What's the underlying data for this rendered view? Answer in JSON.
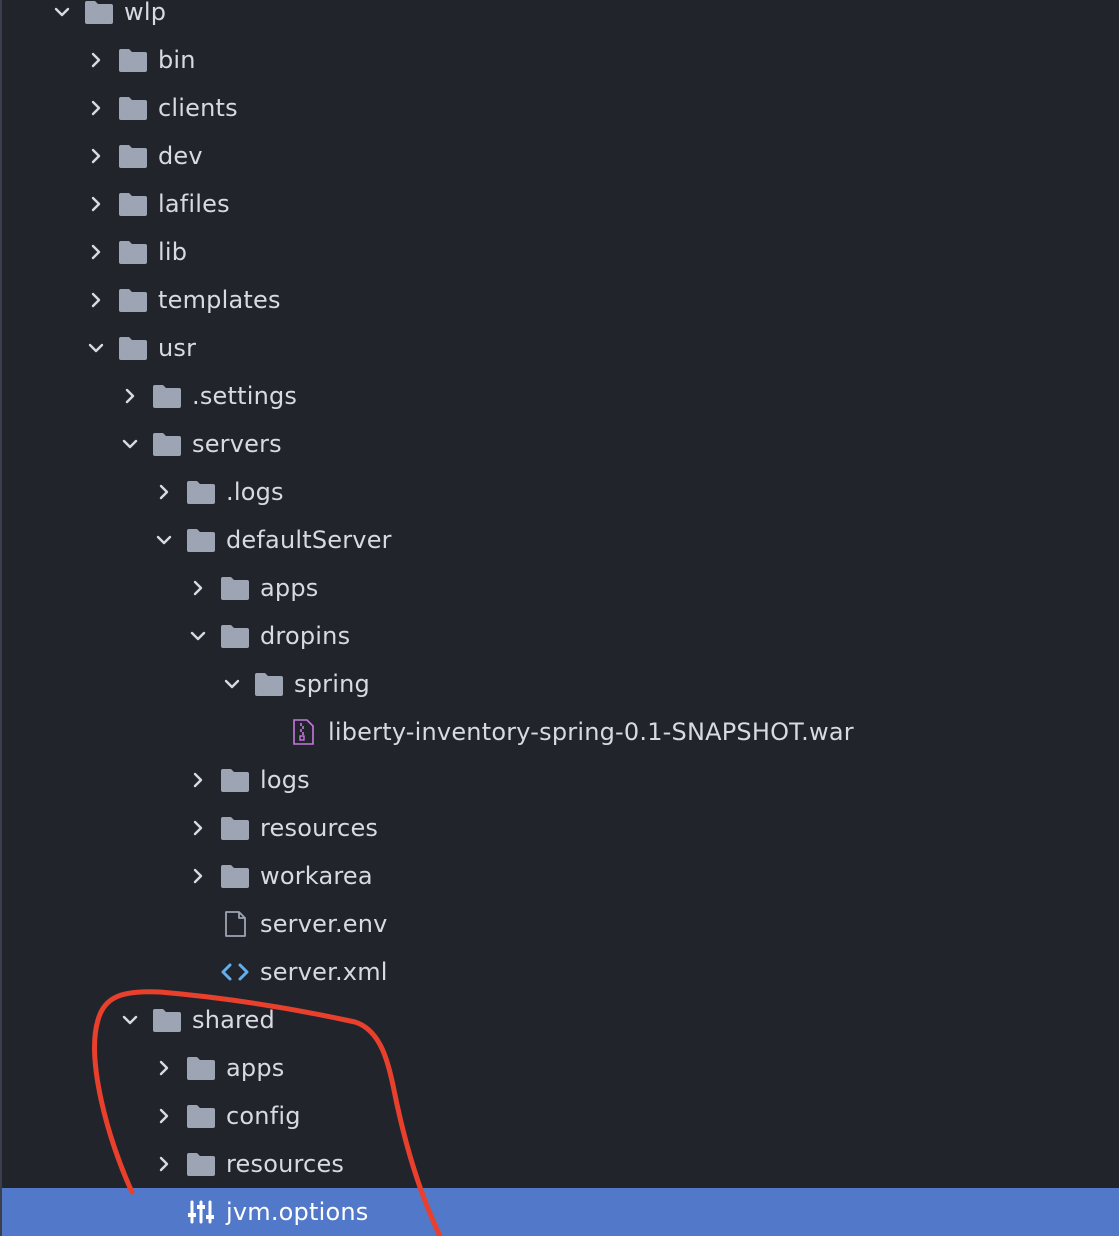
{
  "tree": {
    "items": [
      {
        "label": "wlp",
        "depth": 0,
        "type": "folder",
        "expanded": true
      },
      {
        "label": "bin",
        "depth": 1,
        "type": "folder",
        "expanded": false
      },
      {
        "label": "clients",
        "depth": 1,
        "type": "folder",
        "expanded": false
      },
      {
        "label": "dev",
        "depth": 1,
        "type": "folder",
        "expanded": false
      },
      {
        "label": "lafiles",
        "depth": 1,
        "type": "folder",
        "expanded": false
      },
      {
        "label": "lib",
        "depth": 1,
        "type": "folder",
        "expanded": false
      },
      {
        "label": "templates",
        "depth": 1,
        "type": "folder",
        "expanded": false
      },
      {
        "label": "usr",
        "depth": 1,
        "type": "folder",
        "expanded": true
      },
      {
        "label": ".settings",
        "depth": 2,
        "type": "folder",
        "expanded": false
      },
      {
        "label": "servers",
        "depth": 2,
        "type": "folder",
        "expanded": true
      },
      {
        "label": ".logs",
        "depth": 3,
        "type": "folder",
        "expanded": false
      },
      {
        "label": "defaultServer",
        "depth": 3,
        "type": "folder",
        "expanded": true
      },
      {
        "label": "apps",
        "depth": 4,
        "type": "folder",
        "expanded": false
      },
      {
        "label": "dropins",
        "depth": 4,
        "type": "folder",
        "expanded": true
      },
      {
        "label": "spring",
        "depth": 5,
        "type": "folder",
        "expanded": true
      },
      {
        "label": "liberty-inventory-spring-0.1-SNAPSHOT.war",
        "depth": 6,
        "type": "archive"
      },
      {
        "label": "logs",
        "depth": 4,
        "type": "folder",
        "expanded": false
      },
      {
        "label": "resources",
        "depth": 4,
        "type": "folder",
        "expanded": false
      },
      {
        "label": "workarea",
        "depth": 4,
        "type": "folder",
        "expanded": false
      },
      {
        "label": "server.env",
        "depth": 4,
        "type": "file"
      },
      {
        "label": "server.xml",
        "depth": 4,
        "type": "code"
      },
      {
        "label": "shared",
        "depth": 2,
        "type": "folder",
        "expanded": true
      },
      {
        "label": "apps",
        "depth": 3,
        "type": "folder",
        "expanded": false
      },
      {
        "label": "config",
        "depth": 3,
        "type": "folder",
        "expanded": false
      },
      {
        "label": "resources",
        "depth": 3,
        "type": "folder",
        "expanded": false
      },
      {
        "label": "jvm.options",
        "depth": 3,
        "type": "settings",
        "selected": true
      }
    ]
  },
  "colors": {
    "background": "#21252b",
    "text": "#d7dae0",
    "icon": "#9da5b4",
    "selection": "#5279c9",
    "archive_icon": "#c678dd",
    "code_icon": "#61afef",
    "annotation": "#e8402c"
  }
}
